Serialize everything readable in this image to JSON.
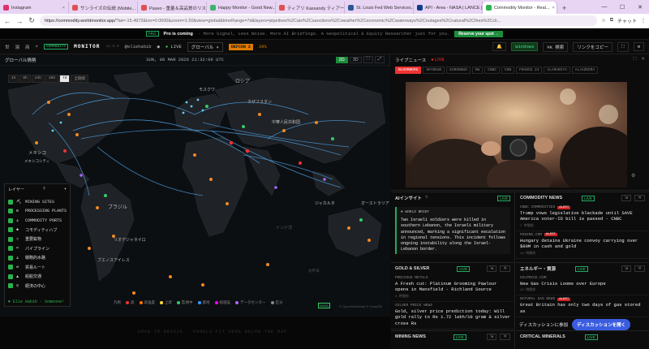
{
  "browser": {
    "tabs": [
      {
        "title": "Instagram",
        "color": "#e1306c"
      },
      {
        "title": "サンライズの伝説 (Mobile...",
        "color": "#e05050"
      },
      {
        "title": "Paseo - 重量＆高品質のリス...",
        "color": "#e05050"
      },
      {
        "title": "Happy Monitor - Good New...",
        "color": "#3cb371"
      },
      {
        "title": "ティアリ Kassandy ティアー特定...",
        "color": "#e05050"
      },
      {
        "title": "St. Louis Fed Web Services...",
        "color": "#2b5797"
      },
      {
        "title": "API - Area - NASA | LANCE |...",
        "color": "#0b3d91"
      },
      {
        "title": "Commodity Monitor - Real...",
        "color": "#2bb34d"
      }
    ],
    "url": "https://commodity.worldmonitor.app/",
    "url_query": "?lat=-15.4972&lon=0.0000&zoom=1.50&view=global&timeRange=7d&layers=pipelines%2Cais%2Csanctions%2Cweather%2Ceconomic%2Cwaterways%2Coutages%2Cnatural%2Cfires%2Ccli...",
    "profile": "チャット"
  },
  "promo": {
    "tag": "PRO",
    "bold": "Pro is coming",
    "text": "· More Signal, Less Noise. More AI Briefings. A Geopolitical & Equity Researcher just for you.",
    "cta": "Reserve your spot →"
  },
  "appbar": {
    "variants": [
      "世",
      "湯",
      "商",
      "☀"
    ],
    "commodity": "COMMODITY",
    "logo": "MONITOR",
    "version": "v2.6.0",
    "user": "@eliehabib",
    "live": "LIVE",
    "region": "グローバル ▾",
    "defcon": "DEFCON 2",
    "defcon_pct": "29%",
    "right": [
      "Windows",
      "⌘K 検索",
      "リンクをコピー"
    ]
  },
  "map": {
    "title": "グローバル情勢",
    "clock": "SUN, 08 MAR 2026 21:32:09 UTC",
    "views": [
      "2D",
      "3D"
    ],
    "time_buttons": [
      "1h",
      "6h",
      "24h",
      "48h",
      "7d",
      "全期間"
    ],
    "active_time": "7d",
    "labels": [
      "ロシア",
      "モスクワ",
      "カザフスタン",
      "中華人民共和国",
      "メキシコ",
      "メキシコシティ",
      "ブラジル",
      "リオデジャネイロ",
      "ブエノスアイレス",
      "ジャカルタ",
      "オーストラリア",
      "インド洋",
      "太平洋"
    ],
    "layers_title": "レイヤー",
    "layers_help": "?",
    "layers": [
      {
        "icon": "⛏",
        "label": "MINING SITES"
      },
      {
        "icon": "⚙",
        "label": "PROCESSING PLANTS"
      },
      {
        "icon": "⚓",
        "label": "COMMODITY PORTS"
      },
      {
        "icon": "◆",
        "label": "コモディティハブ"
      },
      {
        "icon": "≈",
        "label": "重要鉱物"
      },
      {
        "icon": "═",
        "label": "パイプライン"
      },
      {
        "icon": "⚓",
        "label": "戦略的水路"
      },
      {
        "icon": "⇄",
        "label": "貿易ルート"
      },
      {
        "icon": "▲",
        "label": "船舶交通"
      },
      {
        "icon": "◎",
        "label": "経済の中心"
      }
    ],
    "layers_footer": "♥ Elie Habib · Someone²",
    "legend": [
      {
        "label": "高",
        "color": "#e33"
      },
      {
        "label": "高強度",
        "color": "#f70"
      },
      {
        "label": "上昇",
        "color": "#fd3"
      },
      {
        "label": "監視中",
        "color": "#3c6"
      },
      {
        "label": "基地",
        "color": "#39f"
      },
      {
        "label": "核施設",
        "color": "#f0f"
      },
      {
        "label": "データセンター",
        "color": "#a6f"
      },
      {
        "label": "区分",
        "color": "#888"
      }
    ],
    "nasa": "NASA",
    "attribution": "© OpenStreetMap © CartoDB",
    "bottom_text": "DRAG TO RESIZE · PANELS FIT HERE BELOW THE MAP"
  },
  "live_news": {
    "title": "ライブニュース",
    "live": "● LIVE",
    "channels": [
      "BLOOMBERG",
      "SKYNEWS",
      "EURONEWS",
      "DW",
      "CNBC",
      "CNN",
      "FRANCE 24",
      "ALARABIYA",
      "ALJAZEERA"
    ],
    "active": "BLOOMBERG"
  },
  "ai_insight": {
    "title": "AIインサイト",
    "help": "?",
    "live": "LIVE",
    "brief_label": "● WORLD BRIEF",
    "text": "Two Israeli soldiers were killed in southern Lebanon, the Israeli military announced, marking a significant escalation in regional tensions. This incident follows ongoing instability along the Israel-Lebanon border."
  },
  "commodity_news": {
    "title": "COMMODITY NEWS",
    "live": "LIVE",
    "items": [
      {
        "source": "CNBC COMMODITIES",
        "alert": "ALERT",
        "headline": "Trump vows legislative blackade until SAVE America voter-ID bill is passed - CNBC",
        "ago": "7 時間前"
      },
      {
        "source": "MINING.COM",
        "alert": "ALERT",
        "headline": "Hungary detains Ukraine convoy carrying over $80M in cash and gold",
        "ago": "14 時間前"
      }
    ]
  },
  "gold_silver": {
    "title": "GOLD & SILVER",
    "live": "LIVE",
    "items": [
      {
        "source": "PRECIOUS METALS",
        "headline": "A Fresh cut: Platinum Grooming Pawlour opens in Mansfield - Richland Source",
        "ago": "3 時間前"
      },
      {
        "source": "SILVER PRICE NEWS",
        "headline": "Gold, silver price prediction today: Will gold rally to Rs 1.72 lakh/10 gram & silver cross Rs"
      }
    ]
  },
  "energy": {
    "title": "エネルギー・資源",
    "live": "LIVE",
    "items": [
      {
        "source": "OILPRICE.COM",
        "headline": "New Gas Crisis Looms over Europe",
        "ago": "12 時間前"
      },
      {
        "source": "NATURAL GAS NEWS",
        "alert": "ALERT",
        "headline": "Great Britain has only two days of gas stored as"
      }
    ]
  },
  "mining_news": {
    "title": "MINING NEWS",
    "live": "LIVE"
  },
  "critical_minerals": {
    "title": "CRITICAL MINERALS",
    "live": "LIVE"
  },
  "chat": {
    "label": "ディスカッションに参加",
    "button": "ディスカッションを開く"
  }
}
